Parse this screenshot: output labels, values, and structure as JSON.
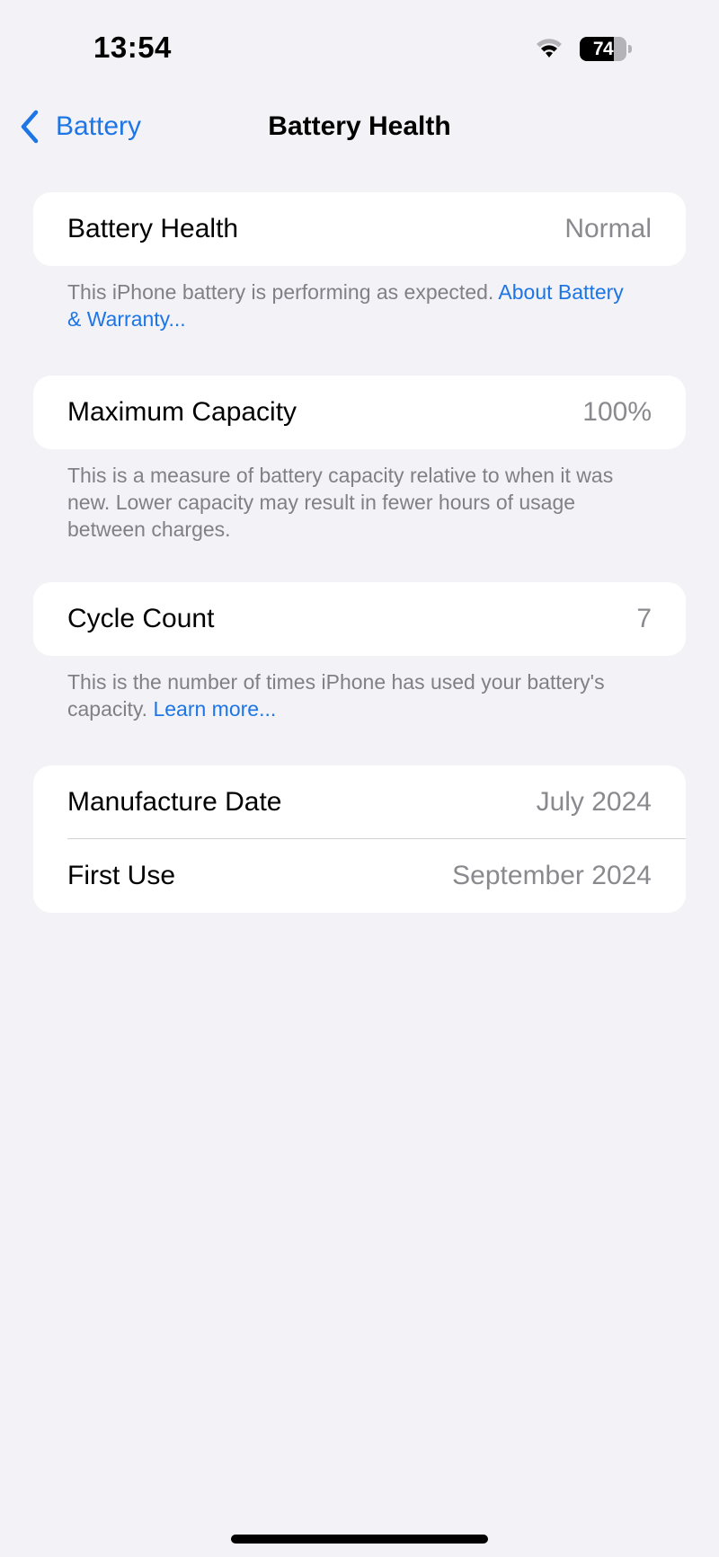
{
  "status_bar": {
    "time": "13:54",
    "wifi_icon": "wifi-icon",
    "wifi_signal_bars": 2,
    "wifi_signal_max": 3,
    "battery_icon": "battery-icon",
    "battery_level": "74",
    "battery_percent": 74
  },
  "nav": {
    "back_icon": "chevron-left-icon",
    "back_label": "Battery",
    "title": "Battery Health"
  },
  "sections": [
    {
      "rows": [
        {
          "label": "Battery Health",
          "value": "Normal"
        }
      ],
      "footer": {
        "text": "This iPhone battery is performing as expected. ",
        "link": "About Battery & Warranty..."
      }
    },
    {
      "rows": [
        {
          "label": "Maximum Capacity",
          "value": "100%"
        }
      ],
      "footer": {
        "text": "This is a measure of battery capacity relative to when it was new. Lower capacity may result in fewer hours of usage between charges.",
        "link": ""
      }
    },
    {
      "rows": [
        {
          "label": "Cycle Count",
          "value": "7"
        }
      ],
      "footer": {
        "text": "This is the number of times iPhone has used your battery's capacity. ",
        "link": "Learn more..."
      }
    },
    {
      "rows": [
        {
          "label": "Manufacture Date",
          "value": "July 2024"
        },
        {
          "label": "First Use",
          "value": "September 2024"
        }
      ]
    }
  ],
  "colors": {
    "accent": "#1d75e6",
    "background": "#f2f2f7",
    "card": "#ffffff",
    "secondary_text": "#8a8a8e",
    "footer_text": "#808085",
    "separator": "#d1d1d6"
  }
}
